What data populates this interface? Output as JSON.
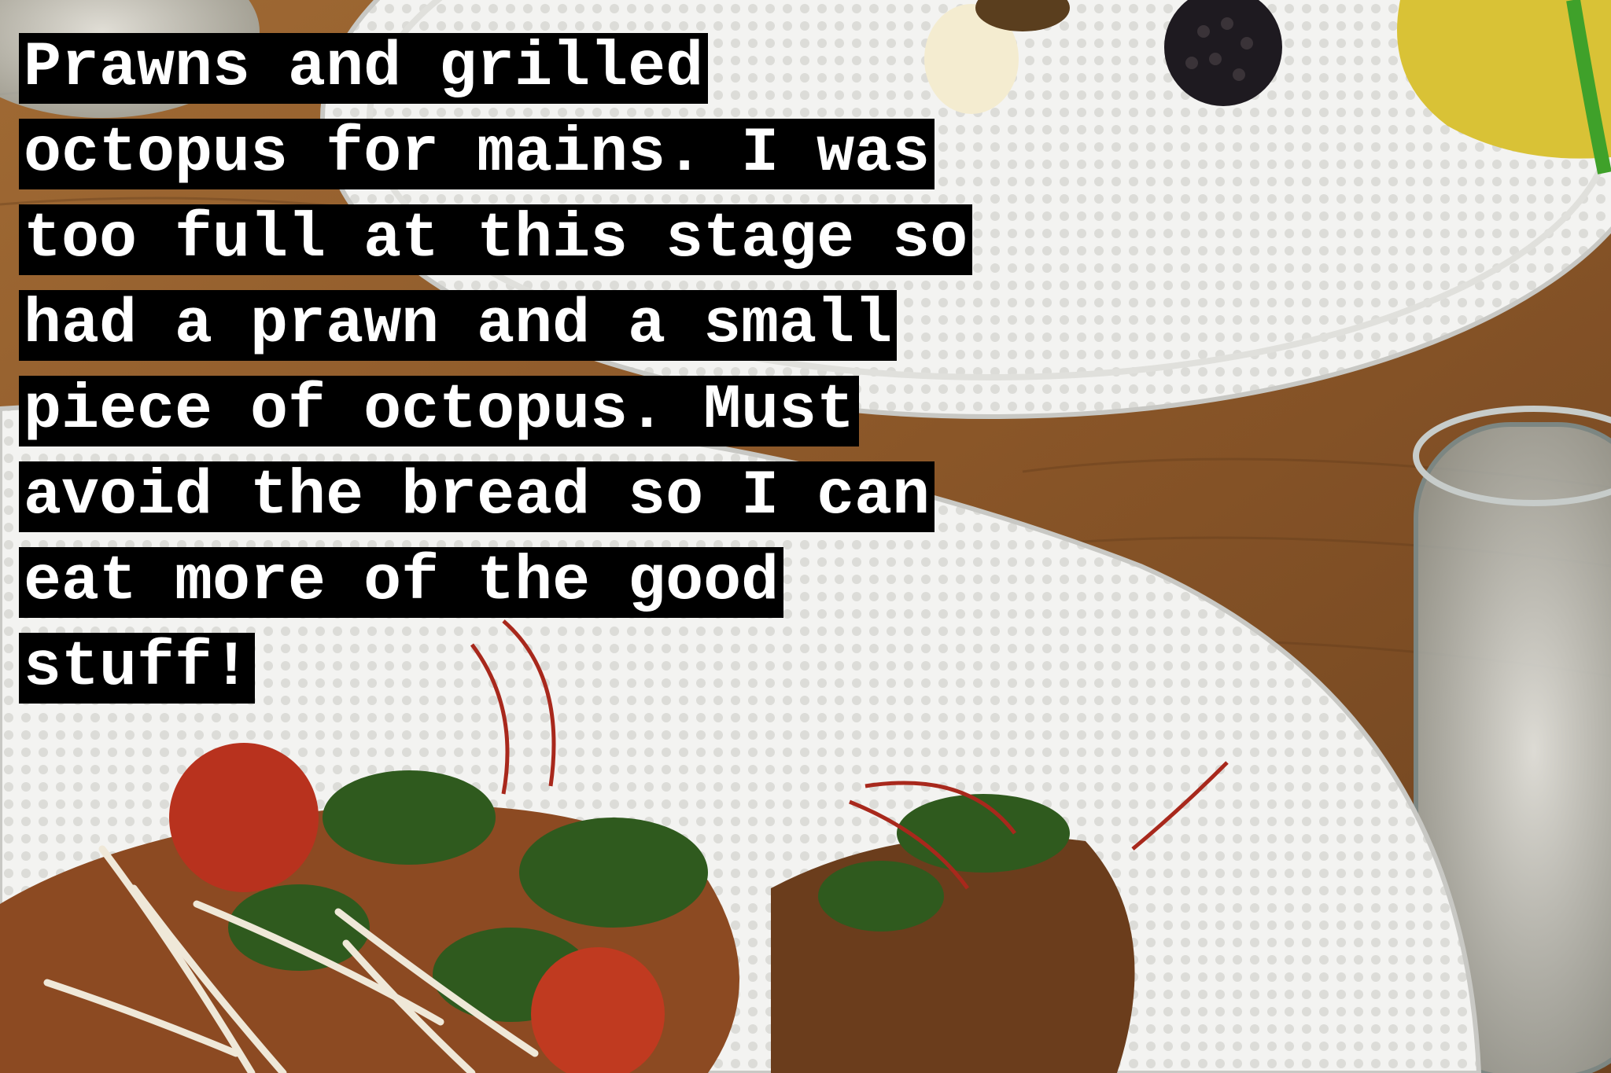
{
  "story_caption": {
    "lines": [
      "Prawns and grilled",
      "octopus for mains. I was",
      "too full at this stage so",
      "had a prawn and a small",
      "piece of octopus. Must",
      "avoid the bread so I can",
      "eat more of the good",
      "stuff!"
    ]
  },
  "colors": {
    "caption_background": "#000000",
    "caption_text": "#ffffff",
    "table_wood": "#8a5a2e",
    "plate": "#f2f2f0"
  }
}
